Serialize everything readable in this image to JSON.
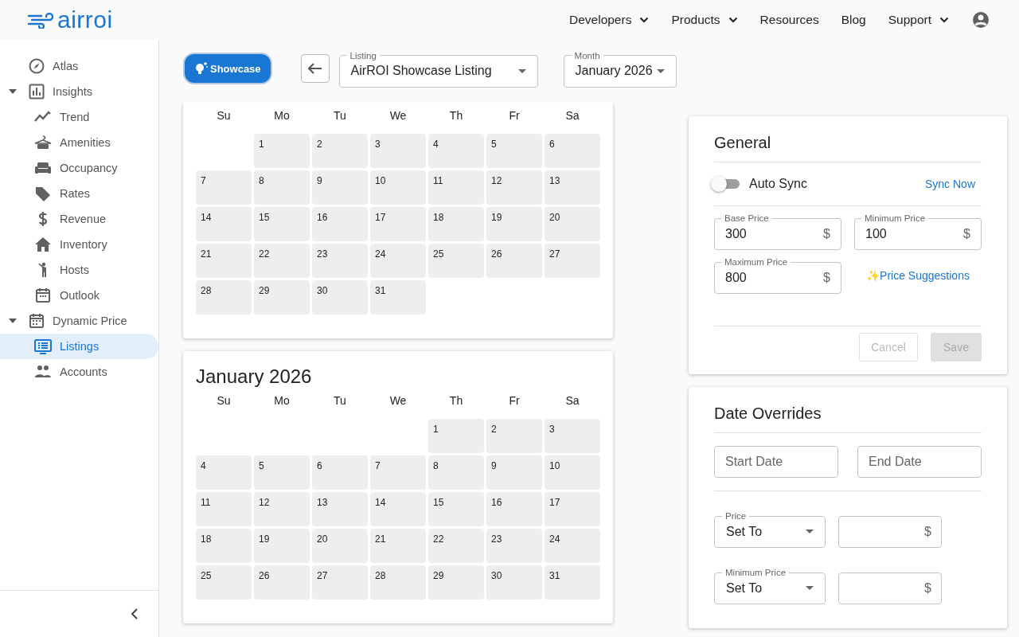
{
  "logo": {
    "text": "airroi"
  },
  "nav": [
    {
      "label": "Developers",
      "menu": true
    },
    {
      "label": "Products",
      "menu": true
    },
    {
      "label": "Resources",
      "menu": false
    },
    {
      "label": "Blog",
      "menu": false
    },
    {
      "label": "Support",
      "menu": true
    }
  ],
  "sidebar": {
    "items": [
      {
        "label": "Atlas",
        "selected": false
      },
      {
        "label": "Insights",
        "selected": false,
        "expanded": true,
        "children": [
          {
            "label": "Trend",
            "selected": false
          },
          {
            "label": "Amenities",
            "selected": false
          },
          {
            "label": "Occupancy",
            "selected": false
          },
          {
            "label": "Rates",
            "selected": false
          },
          {
            "label": "Revenue",
            "selected": false
          },
          {
            "label": "Inventory",
            "selected": false
          },
          {
            "label": "Hosts",
            "selected": false
          },
          {
            "label": "Outlook",
            "selected": false
          }
        ]
      },
      {
        "label": "Dynamic Price",
        "selected": false,
        "expanded": true,
        "children": [
          {
            "label": "Listings",
            "selected": true
          },
          {
            "label": "Accounts",
            "selected": false
          }
        ]
      }
    ]
  },
  "toolbar": {
    "showcase": "Showcase",
    "listing": {
      "label": "Listing",
      "value": "AirROI Showcase Listing"
    },
    "month": {
      "label": "Month",
      "value": "January 2026"
    }
  },
  "calendars": [
    {
      "weekdays": [
        "Su",
        "Mo",
        "Tu",
        "We",
        "Th",
        "Fr",
        "Sa"
      ],
      "weeks": [
        [
          {
            "kind": "blank"
          },
          {
            "kind": "day",
            "label": "1"
          },
          {
            "kind": "day",
            "label": "2"
          },
          {
            "kind": "day",
            "label": "3"
          },
          {
            "kind": "day",
            "label": "4"
          },
          {
            "kind": "day",
            "label": "5"
          },
          {
            "kind": "day",
            "label": "6"
          }
        ],
        [
          {
            "kind": "day",
            "label": "7"
          },
          {
            "kind": "day",
            "label": "8"
          },
          {
            "kind": "day",
            "label": "9"
          },
          {
            "kind": "day",
            "label": "10"
          },
          {
            "kind": "day",
            "label": "11"
          },
          {
            "kind": "day",
            "label": "12"
          },
          {
            "kind": "day",
            "label": "13"
          }
        ],
        [
          {
            "kind": "day",
            "label": "14"
          },
          {
            "kind": "day",
            "label": "15"
          },
          {
            "kind": "day",
            "label": "16"
          },
          {
            "kind": "day",
            "label": "17"
          },
          {
            "kind": "day",
            "label": "18"
          },
          {
            "kind": "day",
            "label": "19"
          },
          {
            "kind": "day",
            "label": "20"
          }
        ],
        [
          {
            "kind": "day",
            "label": "21"
          },
          {
            "kind": "day",
            "label": "22"
          },
          {
            "kind": "day",
            "label": "23"
          },
          {
            "kind": "day",
            "label": "24"
          },
          {
            "kind": "day",
            "label": "25"
          },
          {
            "kind": "day",
            "label": "26"
          },
          {
            "kind": "day",
            "label": "27"
          }
        ],
        [
          {
            "kind": "day",
            "label": "28"
          },
          {
            "kind": "day",
            "label": "29"
          },
          {
            "kind": "day",
            "label": "30"
          },
          {
            "kind": "day",
            "label": "31"
          },
          {
            "kind": "blank"
          },
          {
            "kind": "blank"
          },
          {
            "kind": "blank"
          }
        ]
      ]
    },
    {
      "title": "January 2026",
      "weekdays": [
        "Su",
        "Mo",
        "Tu",
        "We",
        "Th",
        "Fr",
        "Sa"
      ],
      "weeks": [
        [
          {
            "kind": "blank"
          },
          {
            "kind": "blank"
          },
          {
            "kind": "blank"
          },
          {
            "kind": "blank"
          },
          {
            "kind": "day",
            "label": "1"
          },
          {
            "kind": "day",
            "label": "2"
          },
          {
            "kind": "day",
            "label": "3"
          }
        ],
        [
          {
            "kind": "day",
            "label": "4"
          },
          {
            "kind": "day",
            "label": "5"
          },
          {
            "kind": "day",
            "label": "6"
          },
          {
            "kind": "day",
            "label": "7"
          },
          {
            "kind": "day",
            "label": "8"
          },
          {
            "kind": "day",
            "label": "9"
          },
          {
            "kind": "day",
            "label": "10"
          }
        ],
        [
          {
            "kind": "day",
            "label": "11"
          },
          {
            "kind": "day",
            "label": "12"
          },
          {
            "kind": "day",
            "label": "13"
          },
          {
            "kind": "day",
            "label": "14"
          },
          {
            "kind": "day",
            "label": "15"
          },
          {
            "kind": "day",
            "label": "16"
          },
          {
            "kind": "day",
            "label": "17"
          }
        ],
        [
          {
            "kind": "day",
            "label": "18"
          },
          {
            "kind": "day",
            "label": "19"
          },
          {
            "kind": "day",
            "label": "20"
          },
          {
            "kind": "day",
            "label": "21"
          },
          {
            "kind": "day",
            "label": "22"
          },
          {
            "kind": "day",
            "label": "23"
          },
          {
            "kind": "day",
            "label": "24"
          }
        ],
        [
          {
            "kind": "day",
            "label": "25"
          },
          {
            "kind": "day",
            "label": "26"
          },
          {
            "kind": "day",
            "label": "27"
          },
          {
            "kind": "day",
            "label": "28"
          },
          {
            "kind": "day",
            "label": "29"
          },
          {
            "kind": "day",
            "label": "30"
          },
          {
            "kind": "day",
            "label": "31"
          }
        ]
      ]
    }
  ],
  "general": {
    "title": "General",
    "auto_sync": {
      "label": "Auto Sync",
      "on": false
    },
    "sync_now": "Sync Now",
    "fields": [
      {
        "label": "Base Price",
        "value": "300",
        "suffix": "$"
      },
      {
        "label": "Minimum Price",
        "value": "100",
        "suffix": "$"
      },
      {
        "label": "Maximum Price",
        "value": "800",
        "suffix": "$"
      }
    ],
    "suggestions": "✨Price Suggestions",
    "cancel": {
      "label": "Cancel",
      "disabled": true
    },
    "save": {
      "label": "Save",
      "disabled": true
    }
  },
  "overrides": {
    "title": "Date Overrides",
    "start": {
      "placeholder": "Start Date"
    },
    "end": {
      "placeholder": "End Date"
    },
    "rows": [
      {
        "label": "Price",
        "value": "Set To",
        "suffix": "$"
      },
      {
        "label": "Minimum Price",
        "value": "Set To",
        "suffix": "$"
      }
    ]
  }
}
